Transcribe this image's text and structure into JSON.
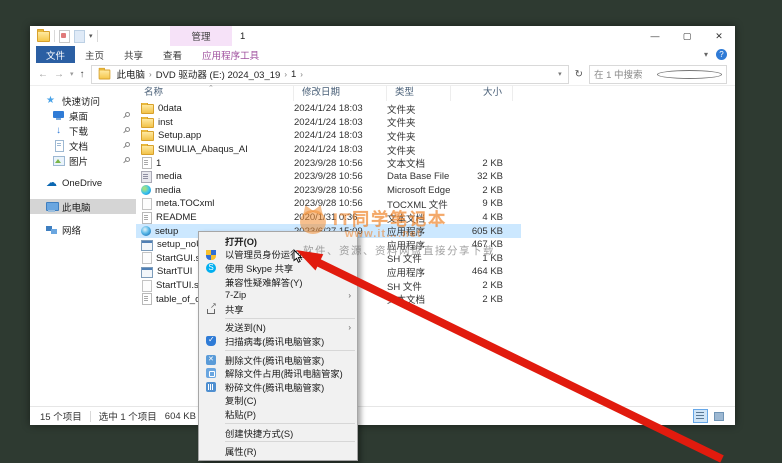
{
  "window": {
    "title": "1",
    "manage_tab": "管理",
    "controls": {
      "minimize": "—",
      "maximize": "▢",
      "close": "✕",
      "help": "?",
      "collapse": "▾"
    },
    "ribbon": {
      "file_tab": "文件",
      "tabs": [
        "主页",
        "共享",
        "查看"
      ],
      "contextual_tab": "应用程序工具"
    },
    "address": {
      "crumbs": [
        "此电脑",
        "DVD 驱动器 (E:) 2024_03_19",
        "1"
      ],
      "search_placeholder": "在 1 中搜索"
    }
  },
  "sidebar": {
    "items": [
      {
        "label": "快速访问",
        "icon": "star-icon",
        "level": 0,
        "glyph": "★"
      },
      {
        "label": "桌面",
        "icon": "desktop-icon",
        "level": 1,
        "pinned": true
      },
      {
        "label": "下载",
        "icon": "download-icon",
        "level": 1,
        "pinned": true,
        "glyph": "↓"
      },
      {
        "label": "文档",
        "icon": "document-icon",
        "level": 1,
        "pinned": true
      },
      {
        "label": "图片",
        "icon": "pictures-icon",
        "level": 1,
        "pinned": true
      },
      {
        "label": "OneDrive",
        "icon": "onedrive-icon",
        "level": 0,
        "glyph": "☁",
        "gap_before": true
      },
      {
        "label": "此电脑",
        "icon": "computer-icon",
        "level": 0,
        "selected": true,
        "gap_before": true
      },
      {
        "label": "网络",
        "icon": "network-icon",
        "level": 0,
        "gap_before": true
      }
    ]
  },
  "file_list": {
    "columns": [
      "名称",
      "修改日期",
      "类型",
      "大小"
    ],
    "rows": [
      {
        "name": "0data",
        "date": "2024/1/24 18:03",
        "type": "文件夹",
        "size": "",
        "icon": "folder-icon"
      },
      {
        "name": "inst",
        "date": "2024/1/24 18:03",
        "type": "文件夹",
        "size": "",
        "icon": "folder-icon"
      },
      {
        "name": "Setup.app",
        "date": "2024/1/24 18:03",
        "type": "文件夹",
        "size": "",
        "icon": "folder-icon"
      },
      {
        "name": "SIMULIA_Abaqus_AI",
        "date": "2024/1/24 18:03",
        "type": "文件夹",
        "size": "",
        "icon": "folder-icon"
      },
      {
        "name": "1",
        "date": "2023/9/28 10:56",
        "type": "文本文档",
        "size": "2 KB",
        "icon": "text-icon"
      },
      {
        "name": "media",
        "date": "2023/9/28 10:56",
        "type": "Data Base File",
        "size": "32 KB",
        "icon": "db-icon"
      },
      {
        "name": "media",
        "date": "2023/9/28 10:56",
        "type": "Microsoft Edge …",
        "size": "2 KB",
        "icon": "edge-icon"
      },
      {
        "name": "meta.TOCxml",
        "date": "2023/9/28 10:56",
        "type": "TOCXML 文件",
        "size": "9 KB",
        "icon": "file-icon"
      },
      {
        "name": "README",
        "date": "2020/1/31 0:36",
        "type": "文本文档",
        "size": "4 KB",
        "icon": "text-icon"
      },
      {
        "name": "setup",
        "date": "2023/6/27 15:09",
        "type": "应用程序",
        "size": "605 KB",
        "icon": "globe-icon",
        "selected": true
      },
      {
        "name": "setup_noUA",
        "date": "",
        "type": "应用程序",
        "size": "467 KB",
        "icon": "app-icon"
      },
      {
        "name": "StartGUI.sh",
        "date": "",
        "type": "SH 文件",
        "size": "1 KB",
        "icon": "file-icon"
      },
      {
        "name": "StartTUI",
        "date": "",
        "type": "应用程序",
        "size": "464 KB",
        "icon": "app-icon"
      },
      {
        "name": "StartTUI.sh",
        "date": "",
        "type": "SH 文件",
        "size": "2 KB",
        "icon": "file-icon"
      },
      {
        "name": "table_of_co",
        "date": "",
        "type": "文本文档",
        "size": "2 KB",
        "icon": "text-icon"
      }
    ]
  },
  "context_menu": {
    "items": [
      {
        "label": "打开(O)",
        "bold": true
      },
      {
        "label": "以管理员身份运行(A)",
        "icon": "uac-shield-icon"
      },
      {
        "label": "使用 Skype 共享",
        "icon": "skype-icon"
      },
      {
        "label": "兼容性疑难解答(Y)"
      },
      {
        "label": "7-Zip",
        "submenu": true
      },
      {
        "label": "共享",
        "icon": "share-icon"
      },
      {
        "sep": true
      },
      {
        "label": "发送到(N)",
        "submenu": true
      },
      {
        "label": "扫描病毒(腾讯电脑管家)",
        "icon": "scan-shield-icon"
      },
      {
        "sep": true
      },
      {
        "label": "删除文件(腾讯电脑管家)",
        "icon": "delete-file-icon"
      },
      {
        "label": "解除文件占用(腾讯电脑管家)",
        "icon": "unlock-file-icon"
      },
      {
        "label": "粉碎文件(腾讯电脑管家)",
        "icon": "shred-file-icon"
      },
      {
        "label": "复制(C)"
      },
      {
        "label": "粘贴(P)"
      },
      {
        "sep": true
      },
      {
        "label": "创建快捷方式(S)"
      },
      {
        "sep": true
      },
      {
        "label": "属性(R)"
      }
    ]
  },
  "status_bar": {
    "items_count": "15 个项目",
    "selected_count": "选中 1 个项目",
    "selected_size": "604 KB"
  },
  "watermark": {
    "title": "IT同学笔记本",
    "url": "www.it….net",
    "line": "软件、资源、资料网盘直接分享下载"
  },
  "colors": {
    "accent_blue": "#2b5fa3",
    "selection": "#cce8ff",
    "contextual_pink": "#f6e2f8",
    "arrow_red": "#e11b0e",
    "watermark_orange": "#ee8228"
  }
}
